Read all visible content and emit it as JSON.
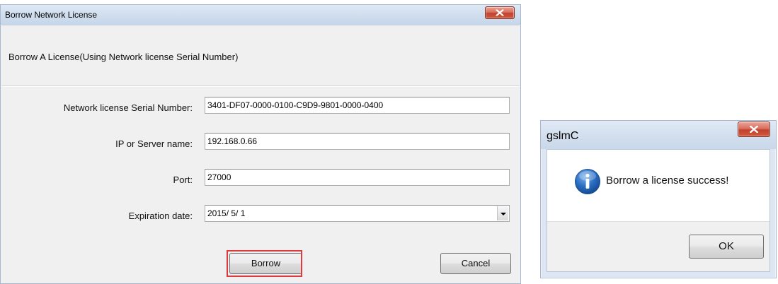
{
  "borrow_dialog": {
    "title": "Borrow Network License",
    "heading": "Borrow A License(Using Network license Serial Number)",
    "fields": [
      {
        "label": "Network license Serial Number:",
        "value": "3401-DF07-0000-0100-C9D9-9801-0000-0400"
      },
      {
        "label": "IP or Server name:",
        "value": "192.168.0.66"
      },
      {
        "label": "Port:",
        "value": "27000"
      },
      {
        "label": "Expiration date:",
        "value": "2015/ 5/ 1"
      }
    ],
    "borrow_button": "Borrow",
    "cancel_button": "Cancel"
  },
  "message_box": {
    "title": "gslmC",
    "message": "Borrow a license success!",
    "ok_button": "OK",
    "icon": "info-icon"
  },
  "colors": {
    "highlight_border": "#e0393e",
    "close_button": "#c2412c",
    "info_icon": "#1e5fb3"
  }
}
